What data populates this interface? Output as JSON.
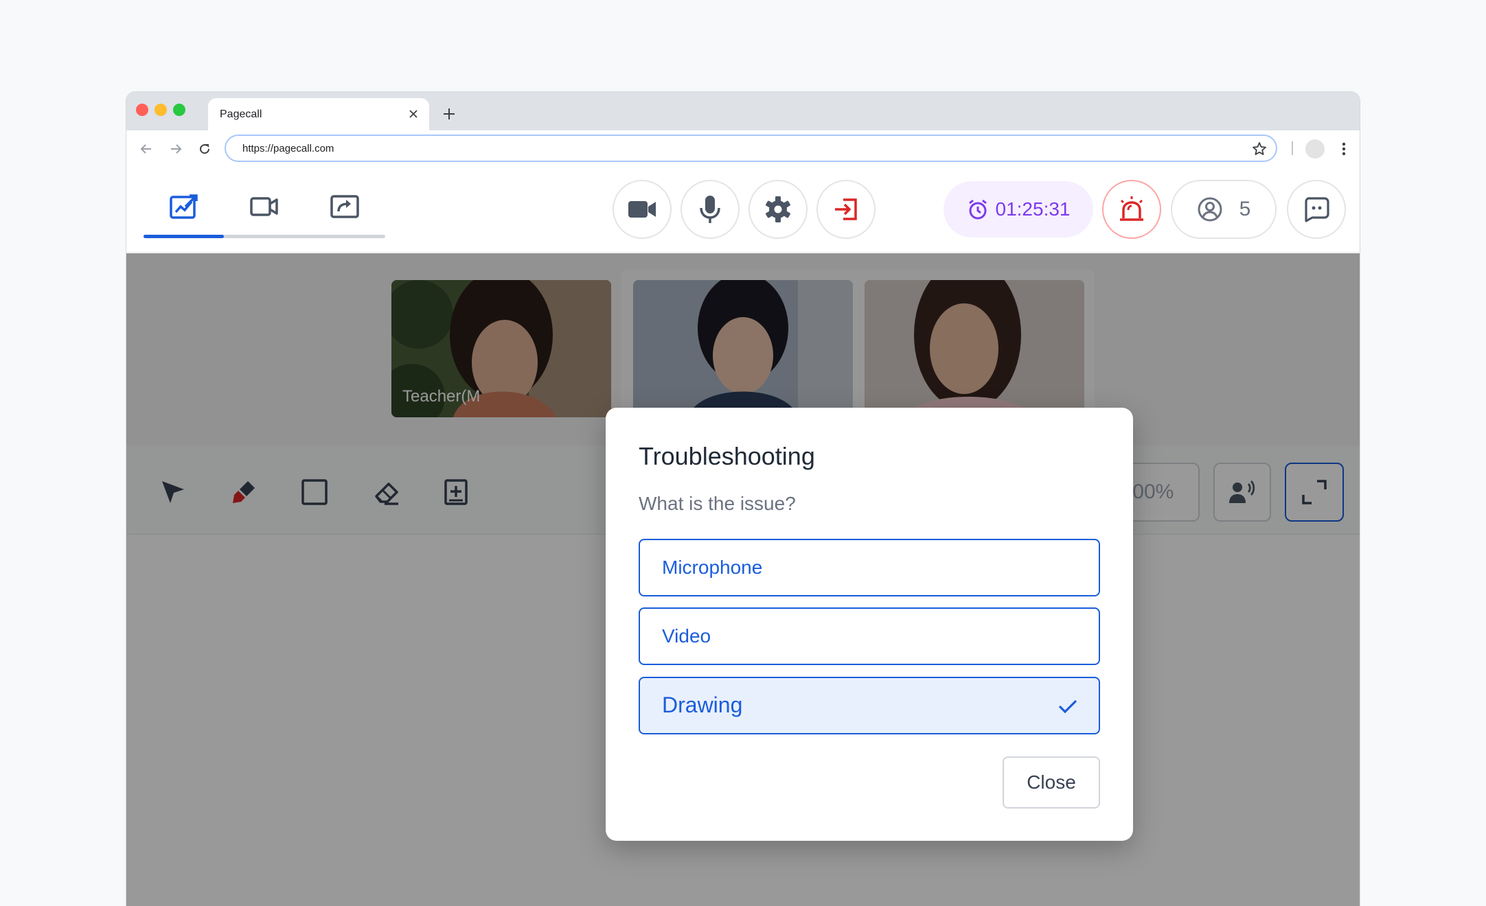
{
  "browser": {
    "tab_title": "Pagecall",
    "url": "https://pagecall.com"
  },
  "app": {
    "view_tabs": [
      {
        "name": "whiteboard",
        "icon": "whiteboard-icon",
        "active": true
      },
      {
        "name": "video",
        "icon": "video-camera-icon",
        "active": false
      },
      {
        "name": "screen-share",
        "icon": "screen-share-icon",
        "active": false
      }
    ],
    "controls": [
      "camera-icon",
      "microphone-icon",
      "gear-icon",
      "exit-icon"
    ],
    "timer": "01:25:31",
    "participants_count": "5",
    "video_labels": [
      "Teacher(M"
    ],
    "zoom_level": "100%",
    "colors": {
      "accent": "#1a5ddb",
      "timer": "#7c3aed",
      "alert": "#dc2626"
    }
  },
  "modal": {
    "title": "Troubleshooting",
    "subtitle": "What is the issue?",
    "options": [
      {
        "label": "Microphone",
        "selected": false
      },
      {
        "label": "Video",
        "selected": false
      },
      {
        "label": "Drawing",
        "selected": true
      }
    ],
    "close_label": "Close"
  }
}
